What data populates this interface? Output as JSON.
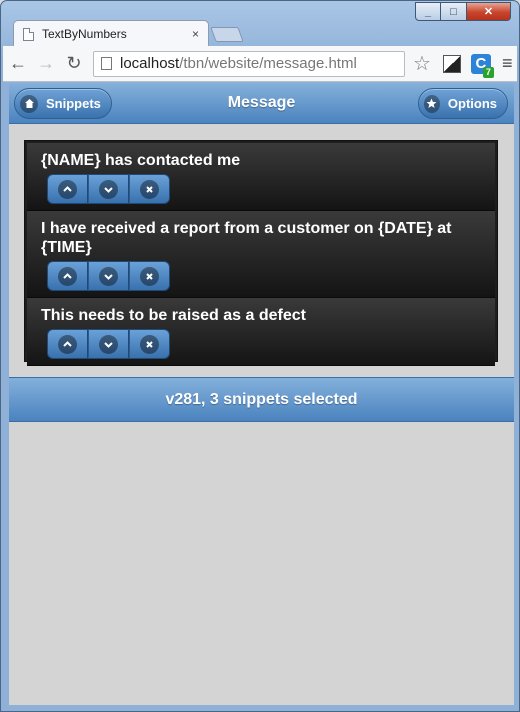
{
  "browser": {
    "tab_title": "TextByNumbers",
    "tab_close": "×",
    "url_host": "localhost",
    "url_path": "/tbn/website/message.html",
    "extension_badge": "7",
    "extension_letter": "C"
  },
  "header": {
    "left_button": "Snippets",
    "title": "Message",
    "right_button": "Options"
  },
  "snippets": [
    {
      "text": "{NAME} has contacted me"
    },
    {
      "text": "I have received a report from a customer on {DATE} at {TIME}"
    },
    {
      "text": "This needs to be raised as a defect"
    }
  ],
  "footer": {
    "status": "v281, 3 snippets selected"
  }
}
